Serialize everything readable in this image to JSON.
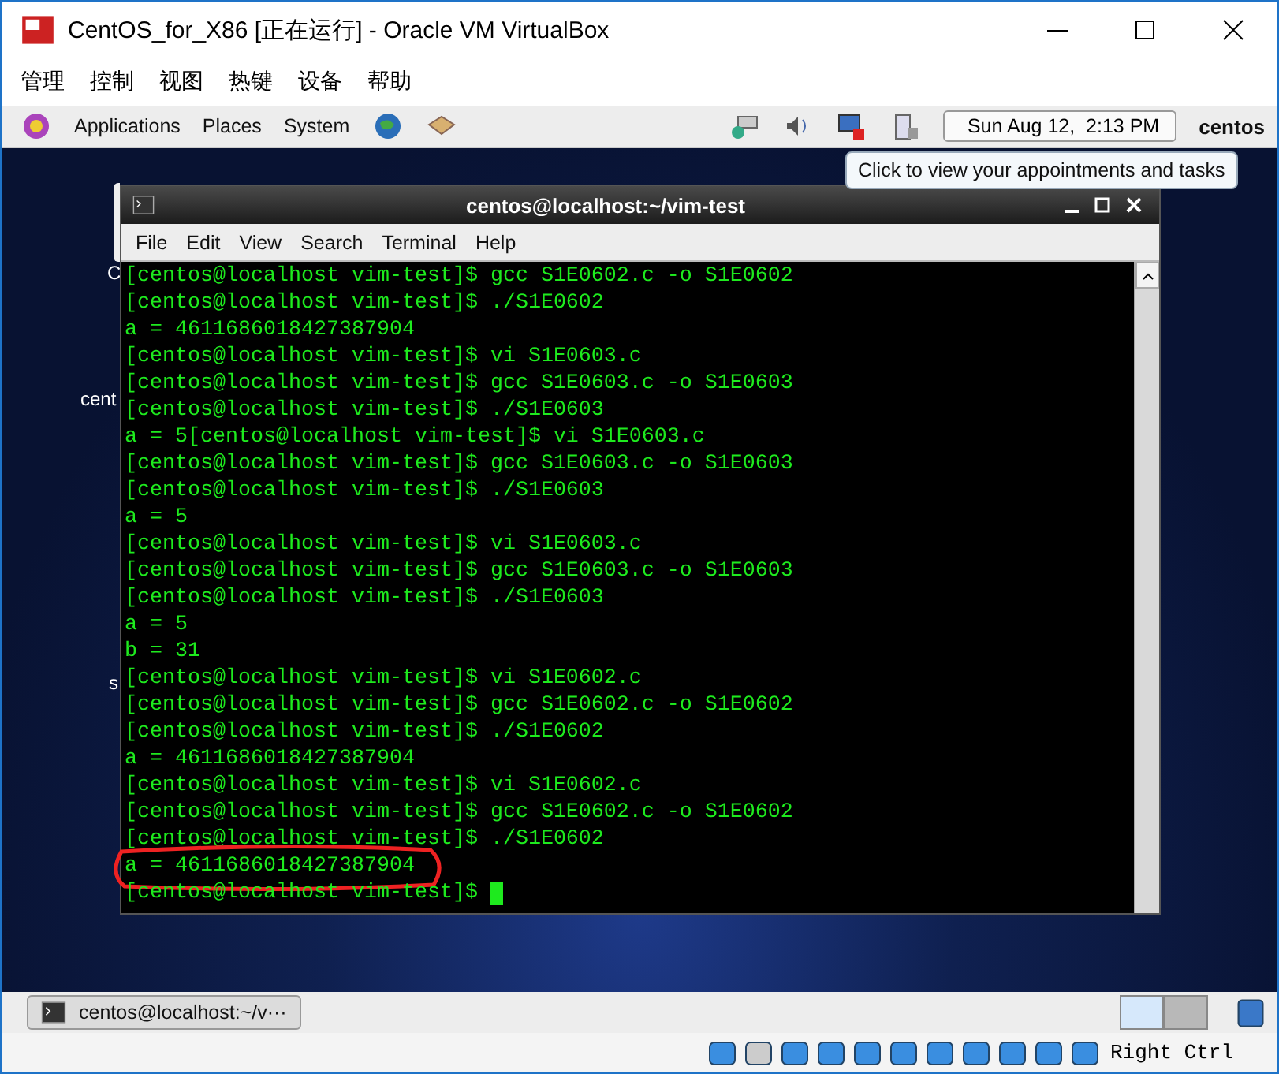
{
  "window": {
    "title": "CentOS_for_X86 [正在运行] - Oracle VM VirtualBox"
  },
  "menu": [
    "管理",
    "控制",
    "视图",
    "热键",
    "设备",
    "帮助"
  ],
  "top_panel": {
    "menus": [
      "Applications",
      "Places",
      "System"
    ],
    "clock": "Sun Aug 12,  2:13 PM",
    "user": "centos"
  },
  "tooltip": "Click to view your appointments and tasks",
  "desktop_icons": [
    {
      "label": "C"
    },
    {
      "label": "cent"
    },
    {
      "label": "s"
    }
  ],
  "terminal": {
    "title": "centos@localhost:~/vim-test",
    "menu": [
      "File",
      "Edit",
      "View",
      "Search",
      "Terminal",
      "Help"
    ],
    "lines": [
      {
        "text": "[centos@localhost vim-test]$ gcc S1E0602.c -o S1E0602",
        "circled": false,
        "cursor": false
      },
      {
        "text": "[centos@localhost vim-test]$ ./S1E0602",
        "circled": false,
        "cursor": false
      },
      {
        "text": "a = 4611686018427387904",
        "circled": false,
        "cursor": false
      },
      {
        "text": "[centos@localhost vim-test]$ vi S1E0603.c",
        "circled": false,
        "cursor": false
      },
      {
        "text": "[centos@localhost vim-test]$ gcc S1E0603.c -o S1E0603",
        "circled": false,
        "cursor": false
      },
      {
        "text": "[centos@localhost vim-test]$ ./S1E0603",
        "circled": false,
        "cursor": false
      },
      {
        "text": "a = 5[centos@localhost vim-test]$ vi S1E0603.c",
        "circled": false,
        "cursor": false
      },
      {
        "text": "[centos@localhost vim-test]$ gcc S1E0603.c -o S1E0603",
        "circled": false,
        "cursor": false
      },
      {
        "text": "[centos@localhost vim-test]$ ./S1E0603",
        "circled": false,
        "cursor": false
      },
      {
        "text": "a = 5",
        "circled": false,
        "cursor": false
      },
      {
        "text": "[centos@localhost vim-test]$ vi S1E0603.c",
        "circled": false,
        "cursor": false
      },
      {
        "text": "[centos@localhost vim-test]$ gcc S1E0603.c -o S1E0603",
        "circled": false,
        "cursor": false
      },
      {
        "text": "[centos@localhost vim-test]$ ./S1E0603",
        "circled": false,
        "cursor": false
      },
      {
        "text": "a = 5",
        "circled": false,
        "cursor": false
      },
      {
        "text": "b = 31",
        "circled": false,
        "cursor": false
      },
      {
        "text": "[centos@localhost vim-test]$ vi S1E0602.c",
        "circled": false,
        "cursor": false
      },
      {
        "text": "[centos@localhost vim-test]$ gcc S1E0602.c -o S1E0602",
        "circled": false,
        "cursor": false
      },
      {
        "text": "[centos@localhost vim-test]$ ./S1E0602",
        "circled": false,
        "cursor": false
      },
      {
        "text": "a = 4611686018427387904",
        "circled": false,
        "cursor": false
      },
      {
        "text": "[centos@localhost vim-test]$ vi S1E0602.c",
        "circled": false,
        "cursor": false
      },
      {
        "text": "[centos@localhost vim-test]$ gcc S1E0602.c -o S1E0602",
        "circled": false,
        "cursor": false
      },
      {
        "text": "[centos@localhost vim-test]$ ./S1E0602",
        "circled": false,
        "cursor": false
      },
      {
        "text": "a = 4611686018427387904",
        "circled": true,
        "cursor": false
      },
      {
        "text": "[centos@localhost vim-test]$ ",
        "circled": false,
        "cursor": true
      }
    ]
  },
  "taskbar": {
    "tasks": [
      {
        "label": "centos@localhost:~/v···",
        "selected": false
      }
    ],
    "workspaces": [
      {
        "selected": true
      },
      {
        "selected": false
      }
    ]
  },
  "status_bar": {
    "host_key": "Right Ctrl"
  }
}
